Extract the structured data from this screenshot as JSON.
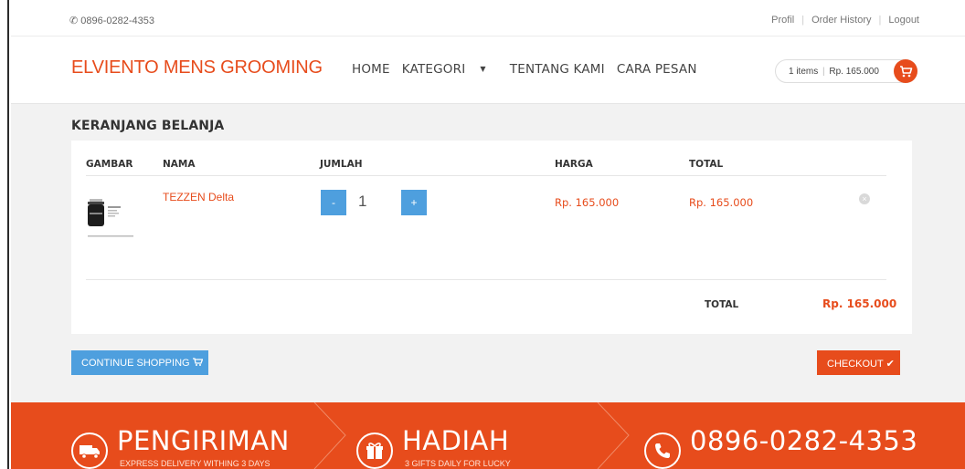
{
  "topbar": {
    "phone": "0896-0282-4353",
    "links": [
      "Profil",
      "Order History",
      "Logout"
    ]
  },
  "navbar": {
    "brand": "ELVIENTO MENS GROOMING",
    "menu": [
      "HOME",
      "KATEGORI",
      "TENTANG KAMI",
      "CARA PESAN"
    ],
    "cart": {
      "items": "1 items",
      "amount": "Rp. 165.000"
    }
  },
  "cart": {
    "title": "KERANJANG BELANJA",
    "columns": [
      "GAMBAR",
      "NAMA",
      "JUMLAH",
      "HARGA",
      "TOTAL"
    ],
    "rows": [
      {
        "name": "TEZZEN Delta",
        "qty": "1",
        "price": "Rp. 165.000",
        "total": "Rp. 165.000"
      }
    ],
    "total_label": "TOTAL",
    "total_value": "Rp. 165.000",
    "minus_label": "-",
    "plus_label": "+",
    "continue_label": "CONTINUE SHOPPING",
    "checkout_label": "CHECKOUT"
  },
  "features": [
    {
      "title": "PENGIRIMAN",
      "subtitle": "EXPRESS DELIVERY WITHING 3 DAYS",
      "icon": "truck-icon"
    },
    {
      "title": "HADIAH",
      "subtitle": "3 GIFTS DAILY FOR LUCKY",
      "icon": "gift-icon"
    },
    {
      "title": "0896-0282-4353",
      "subtitle": "",
      "icon": "phone-icon"
    }
  ],
  "colors": {
    "accent": "#e74c1c",
    "blue": "#4e9fde",
    "panel": "#f2f2f2"
  }
}
